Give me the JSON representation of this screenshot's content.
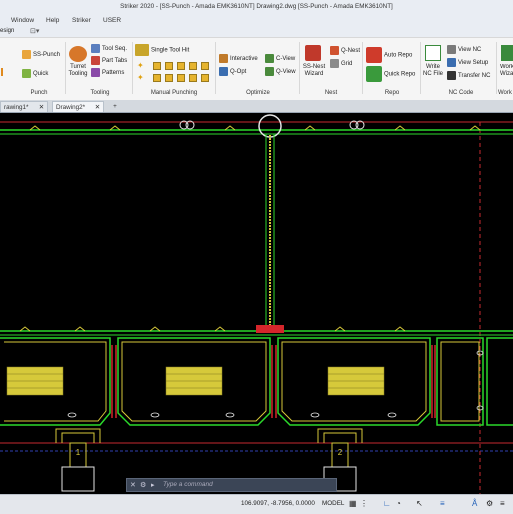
{
  "window": {
    "title": "Striker 2020 - [SS-Punch - Amada EMK3610NT]     Drawing2.dwg    [SS-Punch - Amada EMK3610NT]"
  },
  "menu": {
    "items": [
      "Window",
      "Help",
      "Striker",
      "USER"
    ]
  },
  "quick_access": {
    "partial_label": "esign"
  },
  "ribbon": {
    "punch": {
      "ss_punch": "SS-Punch",
      "quick": "Quick",
      "label": "Punch"
    },
    "tooling": {
      "turret_tooling": "Turret Tooling",
      "tool_seq": "Tool Seq.",
      "part_tabs": "Part Tabs",
      "patterns": "Patterns",
      "label": "Tooling"
    },
    "manual": {
      "single_tool_hit": "Single Tool Hit",
      "label": "Manual Punching"
    },
    "optimize": {
      "interactive": "Interactive",
      "q_opt": "Q-Opt",
      "c_view": "C-View",
      "q_view": "Q-View",
      "label": "Optimize"
    },
    "nest": {
      "ss_nest_wizard": "SS-Nest Wizard",
      "q_nest": "Q-Nest",
      "grid": "Grid",
      "label": "Nest"
    },
    "repo": {
      "auto_repo": "Auto Repo",
      "quick_repo": "Quick Repo",
      "label": "Repo"
    },
    "nc": {
      "write_nc_file": "Write NC File",
      "view_nc": "View NC",
      "view_setup": "View Setup",
      "transfer_nc": "Transfer NC",
      "label": "NC Code"
    },
    "work": {
      "work_wizard": "Work Wiza",
      "label": "Work"
    }
  },
  "tabs": [
    {
      "label": "rawing1*"
    },
    {
      "label": "Drawing2*"
    }
  ],
  "command": {
    "placeholder": "Type a command"
  },
  "status": {
    "coords": "106.9097, -8.7956, 0.0000",
    "model": "MODEL"
  },
  "colors": {
    "part_outline": "#2bd92b",
    "hatch": "#d6c93a",
    "accent_red": "#d4262b",
    "canvas": "#000000"
  }
}
